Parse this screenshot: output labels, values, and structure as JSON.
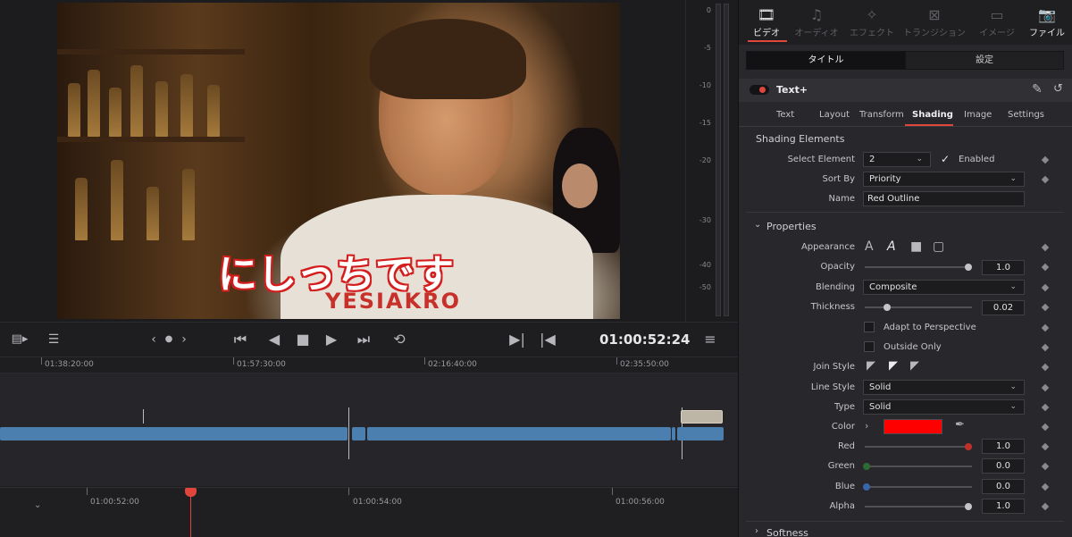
{
  "viewer": {
    "subtitle": "にしっちです",
    "shirt_print": "YESIAKRO"
  },
  "meter": {
    "labels": [
      "0",
      "-5",
      "-10",
      "-15",
      "-20",
      "-30",
      "-40",
      "-50"
    ]
  },
  "transport": {
    "timecode": "01:00:52:24"
  },
  "timeline": {
    "ruler_upper": [
      "01:38:20:00",
      "01:57:30:00",
      "02:16:40:00",
      "02:35:50:00"
    ],
    "ruler_lower": [
      "01:00:52:00",
      "01:00:54:00",
      "01:00:56:00"
    ]
  },
  "inspector": {
    "tabs": [
      {
        "label": "ビデオ",
        "icon": "film-icon"
      },
      {
        "label": "オーディオ",
        "icon": "music-note-icon"
      },
      {
        "label": "エフェクト",
        "icon": "magic-wand-icon"
      },
      {
        "label": "トランジション",
        "icon": "transition-icon"
      },
      {
        "label": "イメージ",
        "icon": "image-icon"
      },
      {
        "label": "ファイル",
        "icon": "camera-icon"
      }
    ],
    "segments": {
      "left": "タイトル",
      "right": "設定"
    },
    "item_name": "Text+",
    "subtabs": [
      "Text",
      "Layout",
      "Transform",
      "Shading",
      "Image",
      "Settings"
    ],
    "shading_elements": {
      "title": "Shading Elements",
      "select_element_label": "Select Element",
      "select_element_value": "2",
      "enabled_label": "Enabled",
      "sort_by_label": "Sort By",
      "sort_by_value": "Priority",
      "name_label": "Name",
      "name_value": "Red Outline"
    },
    "properties": {
      "title": "Properties",
      "appearance_label": "Appearance",
      "opacity_label": "Opacity",
      "opacity_value": "1.0",
      "blending_label": "Blending",
      "blending_value": "Composite",
      "thickness_label": "Thickness",
      "thickness_value": "0.02",
      "adapt_label": "Adapt to Perspective",
      "outside_label": "Outside Only",
      "join_style_label": "Join Style",
      "line_style_label": "Line Style",
      "line_style_value": "Solid",
      "type_label": "Type",
      "type_value": "Solid",
      "color_label": "Color",
      "color_swatch": "#ff0000",
      "red_label": "Red",
      "red_value": "1.0",
      "green_label": "Green",
      "green_value": "0.0",
      "blue_label": "Blue",
      "blue_value": "0.0",
      "alpha_label": "Alpha",
      "alpha_value": "1.0"
    },
    "softness": {
      "title": "Softness"
    }
  },
  "colors": {
    "accent": "#e0463c",
    "clip_blue": "#4a7fb0",
    "clip_beige": "#bdb5a5"
  }
}
